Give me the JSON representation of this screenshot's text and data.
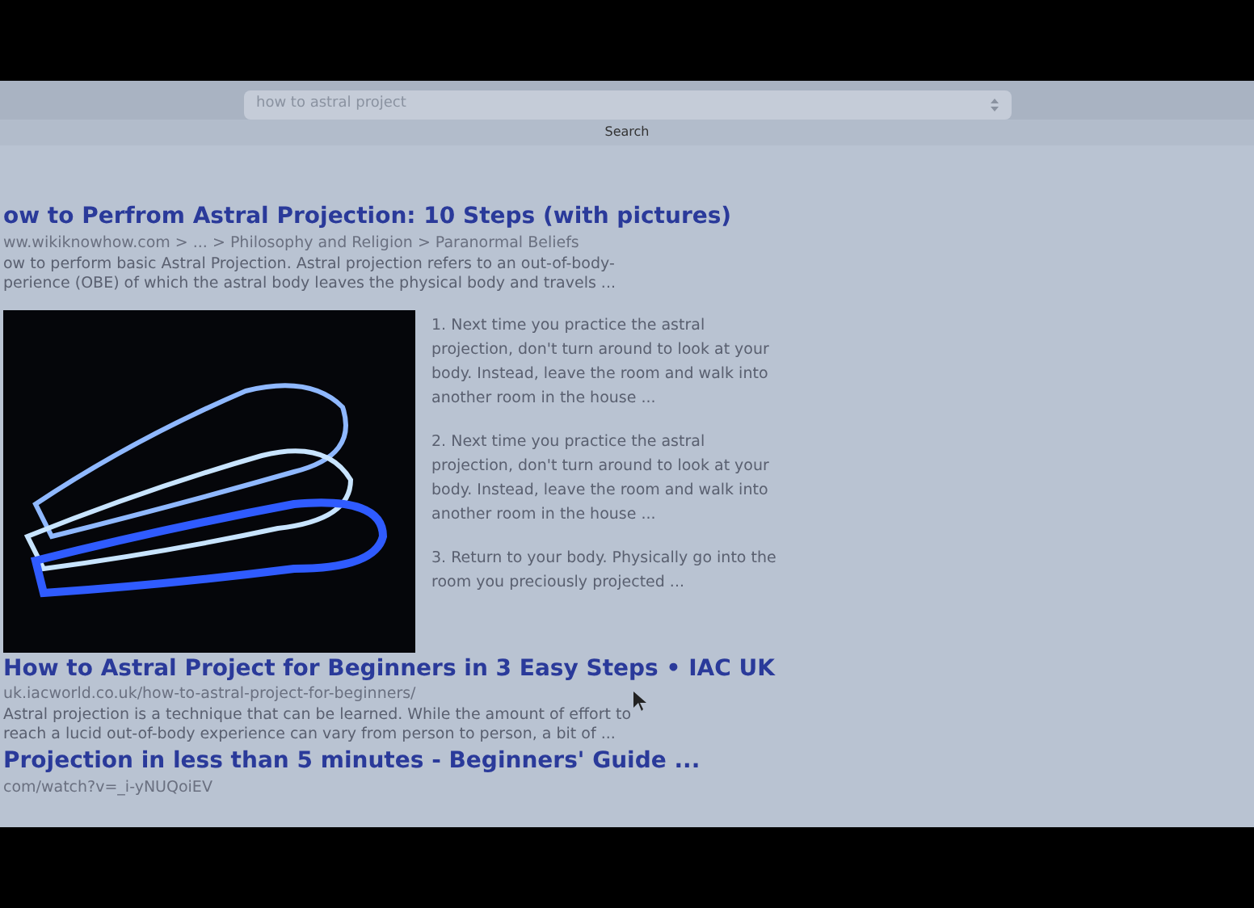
{
  "search": {
    "value": "how to astral project",
    "button": "Search"
  },
  "results": [
    {
      "title": "ow to Perfrom Astral Projection: 10 Steps (with pictures)",
      "url": "ww.wikiknowhow.com > ... > Philosophy and Religion > Paranormal Beliefs",
      "snippet": [
        "ow to perform basic Astral Projection. Astral projection refers to an out-of-body-",
        "perience (OBE) of which the astral body leaves the physical body and travels ..."
      ],
      "steps": [
        "1. Next time you practice the astral projection, don't turn around to look at your body. Instead, leave the room and walk into another room in the house ...",
        "2. Next time you practice the astral projection, don't turn around to look at your body. Instead, leave the room and walk into another room in the house ...",
        "3. Return to your body. Physically go into the room you preciously projected ..."
      ]
    },
    {
      "title": "How to Astral Project for Beginners in 3 Easy Steps • IAC UK",
      "url": "uk.iacworld.co.uk/how-to-astral-project-for-beginners/",
      "snippet": [
        "Astral projection is a technique that can be learned. While the amount of effort to",
        "reach a lucid out-of-body experience can vary from person to person, a bit of ..."
      ]
    },
    {
      "title": "Projection in less than 5 minutes - Beginners' Guide ...",
      "url": "com/watch?v=_i-yNUQoiEV"
    }
  ]
}
